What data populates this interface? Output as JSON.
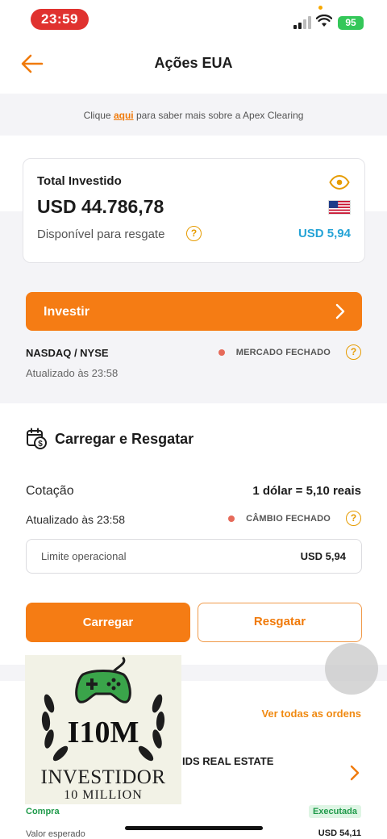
{
  "status_bar": {
    "time": "23:59",
    "battery": "95"
  },
  "nav": {
    "title": "Ações EUA"
  },
  "info": {
    "prefix": "Clique",
    "link": "aqui",
    "suffix": "para saber mais sobre a Apex Clearing"
  },
  "summary": {
    "title": "Total Investido",
    "value": "USD 44.786,78",
    "available_label": "Disponível para resgate",
    "available_value": "USD 5,94",
    "help": "?"
  },
  "invest": {
    "label": "Investir"
  },
  "market": {
    "exchange": "NASDAQ / NYSE",
    "updated": "Atualizado às 23:58",
    "status": "MERCADO FECHADO",
    "help": "?"
  },
  "load_redeem": {
    "title": "Carregar e Resgatar",
    "rate_label": "Cotação",
    "rate_value": "1 dólar = 5,10 reais",
    "updated": "Atualizado às 23:58",
    "status": "CÂMBIO FECHADO",
    "help": "?",
    "limit_label": "Limite operacional",
    "limit_value": "USD 5,94",
    "load_button": "Carregar",
    "redeem_button": "Resgatar"
  },
  "orders": {
    "see_all": "Ver todas as ordens",
    "item": {
      "name": "IDS REAL ESTATE",
      "type": "Compra",
      "status": "Executada",
      "expected_label": "Valor esperado",
      "expected_value": "USD 54,11"
    }
  },
  "overlay_logo": {
    "center": "I10M",
    "line1": "INVESTIDOR",
    "line2": "10 MILLION"
  },
  "colors": {
    "accent": "#f57c14",
    "available": "#24a3d6",
    "status_dot": "#e66a5a",
    "success": "#1f9a4a",
    "time_pill": "#e0322f"
  }
}
